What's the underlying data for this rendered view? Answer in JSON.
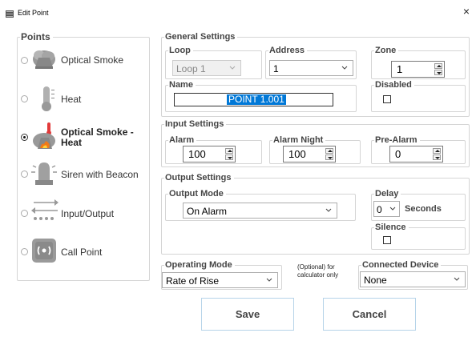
{
  "window": {
    "title": "Edit Point",
    "close_symbol": "×"
  },
  "points": {
    "legend": "Points",
    "items": [
      {
        "label": "Optical Smoke",
        "icon": "smoke-detector-icon",
        "selected": false
      },
      {
        "label": "Heat",
        "icon": "thermometer-icon",
        "selected": false
      },
      {
        "label": "Optical Smoke -",
        "label2": "Heat",
        "icon": "smoke-heat-detector-icon",
        "selected": true
      },
      {
        "label": "Siren with Beacon",
        "icon": "siren-beacon-icon",
        "selected": false
      },
      {
        "label": "Input/Output",
        "icon": "input-output-icon",
        "selected": false
      },
      {
        "label": "Call Point",
        "icon": "call-point-icon",
        "selected": false
      }
    ]
  },
  "general": {
    "legend": "General Settings",
    "loop": {
      "label": "Loop",
      "value": "Loop 1",
      "disabled": true
    },
    "address": {
      "label": "Address",
      "value": "1"
    },
    "zone": {
      "label": "Zone",
      "value": "1"
    },
    "name": {
      "label": "Name",
      "value": "POINT  1.001"
    },
    "disabled": {
      "label": "Disabled",
      "checked": false
    }
  },
  "input": {
    "legend": "Input Settings",
    "alarm": {
      "label": "Alarm",
      "value": "100"
    },
    "alarm_night": {
      "label": "Alarm Night",
      "value": "100"
    },
    "pre_alarm": {
      "label": "Pre-Alarm",
      "value": "0"
    }
  },
  "output": {
    "legend": "Output Settings",
    "mode": {
      "label": "Output Mode",
      "value": "On Alarm"
    },
    "delay": {
      "label": "Delay",
      "value": "0",
      "unit": "Seconds"
    },
    "silence": {
      "label": "Silence",
      "checked": false
    }
  },
  "operating": {
    "label": "Operating Mode",
    "value": "Rate of Rise"
  },
  "optional_note": {
    "line1": "(Optional) for",
    "line2": "calculator only"
  },
  "connected": {
    "label": "Connected Device",
    "value": "None"
  },
  "buttons": {
    "save": "Save",
    "cancel": "Cancel"
  },
  "colors": {
    "selection": "#0078d7",
    "button_border": "#b6d4e9"
  }
}
